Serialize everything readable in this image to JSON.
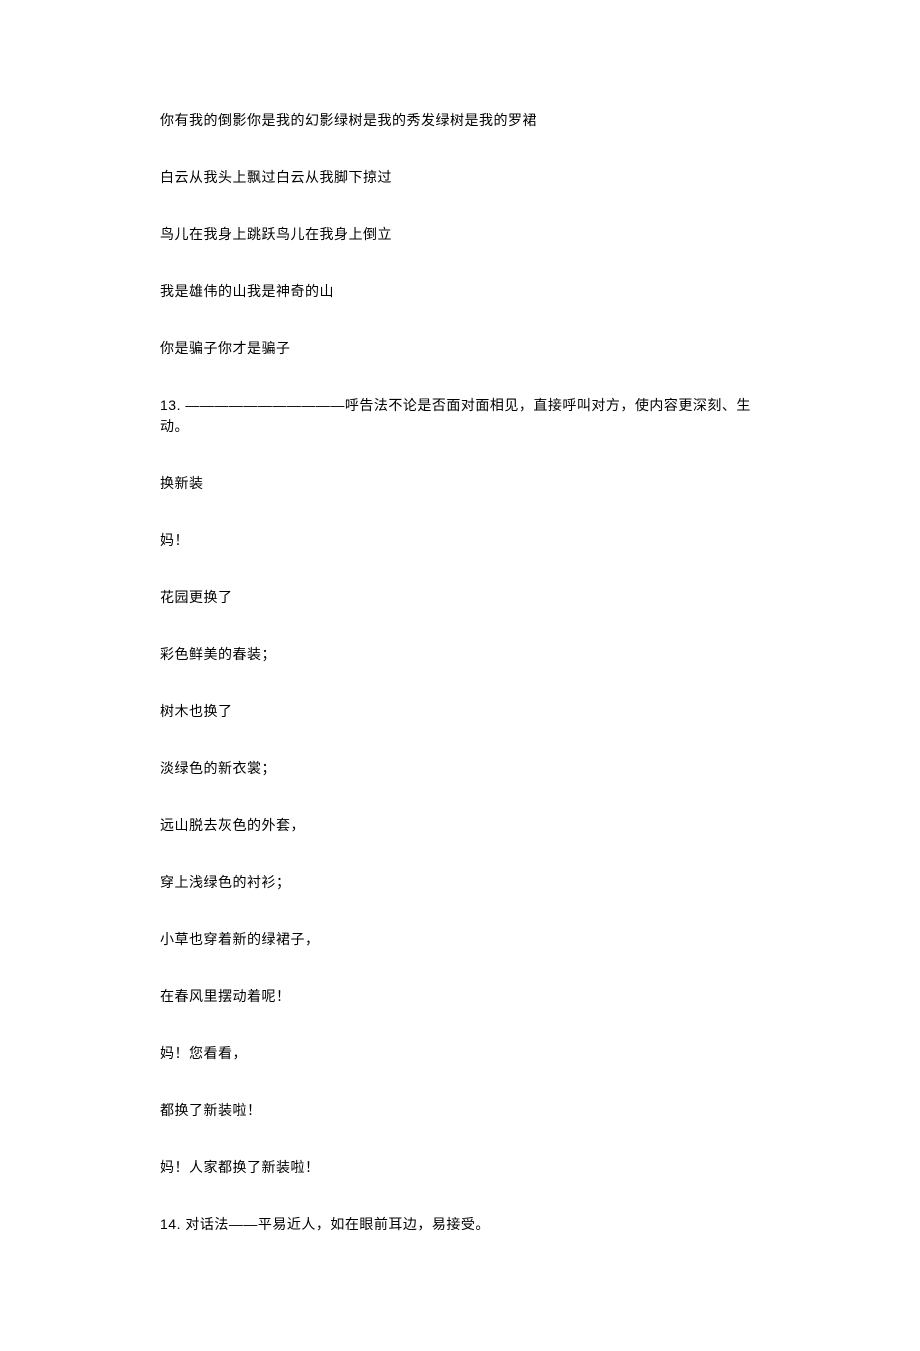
{
  "lines": [
    "你有我的倒影你是我的幻影绿树是我的秀发绿树是我的罗裙",
    "白云从我头上飘过白云从我脚下掠过",
    "鸟儿在我身上跳跃鸟儿在我身上倒立",
    "我是雄伟的山我是神奇的山",
    "你是骗子你才是骗子",
    "13. ―――――――――――呼告法不论是否面对面相见，直接呼叫对方，使内容更深刻、生动。",
    "换新装",
    "妈！",
    "花园更换了",
    "彩色鲜美的春装；",
    "树木也换了",
    "淡绿色的新衣裳；",
    "远山脱去灰色的外套，",
    "穿上浅绿色的衬衫；",
    "小草也穿着新的绿裙子，",
    "在春风里摆动着呢！",
    "妈！您看看，",
    "都换了新装啦！",
    "妈！人家都换了新装啦！",
    "14. 对话法――平易近人，如在眼前耳边，易接受。"
  ]
}
